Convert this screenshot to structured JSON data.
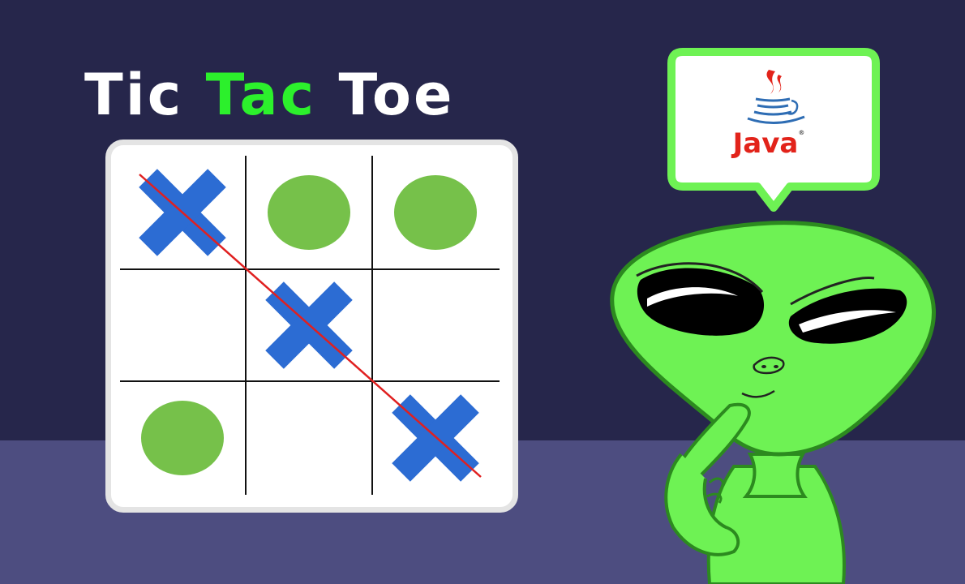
{
  "title": {
    "word1": "Tic",
    "word2": "Tac",
    "word3": "Toe",
    "color_main": "#ffffff",
    "color_accent": "#2cf02c"
  },
  "colors": {
    "background": "#26264b",
    "floor": "#4d4d80",
    "x_mark": "#2c6cd3",
    "o_mark": "#76c14a",
    "win_line": "#e02020",
    "alien_skin": "#6ef254",
    "alien_outline": "#2c8a1f"
  },
  "board": {
    "cells": [
      "X",
      "O",
      "O",
      "",
      "X",
      "",
      "O",
      "",
      "X"
    ],
    "winning_line": "diagonal top-left to bottom-right"
  },
  "speech_bubble": {
    "logo_text": "Java",
    "logo_icon": "java-coffee-cup-icon"
  },
  "character": {
    "name_icon": "thinking-alien-icon"
  }
}
